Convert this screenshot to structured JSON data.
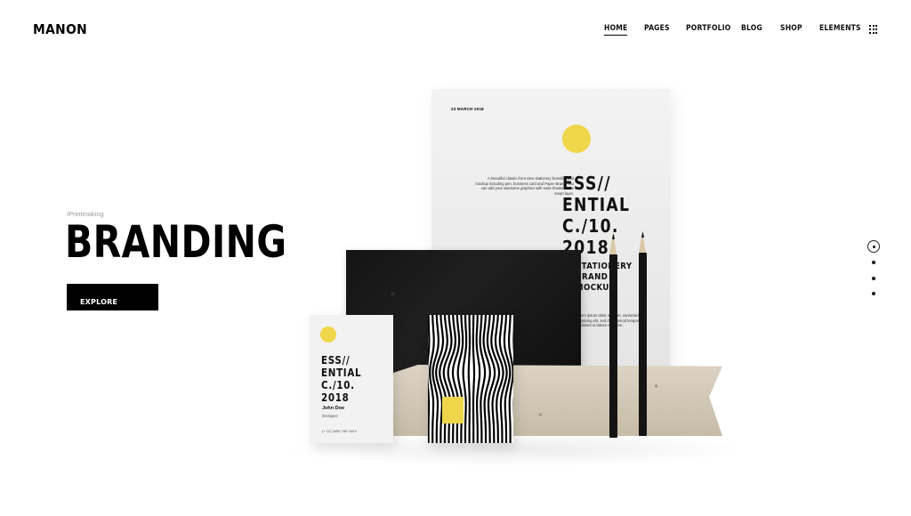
{
  "header": {
    "logo": "MANON",
    "nav": [
      {
        "label": "HOME",
        "active": true
      },
      {
        "label": "PAGES",
        "active": false
      },
      {
        "label": "PORTFOLIO",
        "active": false
      },
      {
        "label": "BLOG",
        "active": false
      },
      {
        "label": "SHOP",
        "active": false
      },
      {
        "label": "ELEMENTS",
        "active": false
      }
    ],
    "menu_icon": "grid-icon"
  },
  "hero": {
    "category": "/Printmaking",
    "title": "BRANDING",
    "button_label": "EXPLORE"
  },
  "pager": {
    "total": 4,
    "active_index": 0
  },
  "mockup": {
    "poster": {
      "date": "23 MARCH 2018",
      "description": "A beautiful classic front view stationery branding psd mockup including pen, business card and Paper Brand. You can add your awesome graphics with ease thanks to the smart layer.",
      "headline": "ESS//\nENTIAL\nC./10.\n2018",
      "subhead": "STATIONERY\nBRAND\nMOCKUP.\n5",
      "body": "Lorem ipsum dolor sit amet, consectetur adipiscing elit, sed do eiusmod tempor incididunt ut labore et dolore."
    },
    "card": {
      "headline": "ESS//\nENTIAL\nC./10.\n2018",
      "name": "John Doe",
      "role": "/Designer",
      "phone": "(+ 12) 3456 789 40XX"
    }
  },
  "colors": {
    "accent_yellow": "#f0d64a",
    "text": "#000000",
    "muted": "#9a9a9a",
    "background": "#ffffff"
  }
}
